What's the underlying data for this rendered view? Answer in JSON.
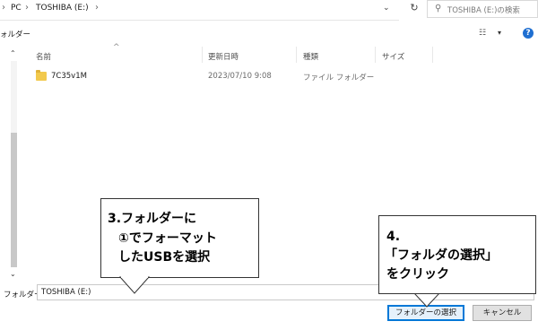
{
  "address": {
    "crumbs": [
      "PC",
      "TOSHIBA (E:)"
    ],
    "separator": "›"
  },
  "search": {
    "placeholder": "TOSHIBA (E:)の検索"
  },
  "toolbar": {
    "new_folder": "ォルダー",
    "view_icon": "view-icon",
    "dropdown": "▾",
    "help": "?"
  },
  "columns": [
    "名前",
    "更新日時",
    "種類",
    "サイズ"
  ],
  "files": [
    {
      "name": "7C35v1M",
      "modified": "2023/07/10 9:08",
      "type": "ファイル フォルダー",
      "size": ""
    }
  ],
  "bottom": {
    "folder_label": "フォルダー:",
    "folder_value": "TOSHIBA (E:)",
    "select_button": "フォルダーの選択",
    "cancel_button": "キャンセル"
  },
  "callouts": {
    "step3": [
      "3.フォルダーに",
      "①でフォーマット",
      "したUSBを選択"
    ],
    "step4": [
      "4.",
      "「フォルダの選択」",
      "をクリック"
    ]
  },
  "colors": {
    "accent": "#0078d7",
    "folder": "#f2c94c",
    "help": "#1f6fd1"
  }
}
